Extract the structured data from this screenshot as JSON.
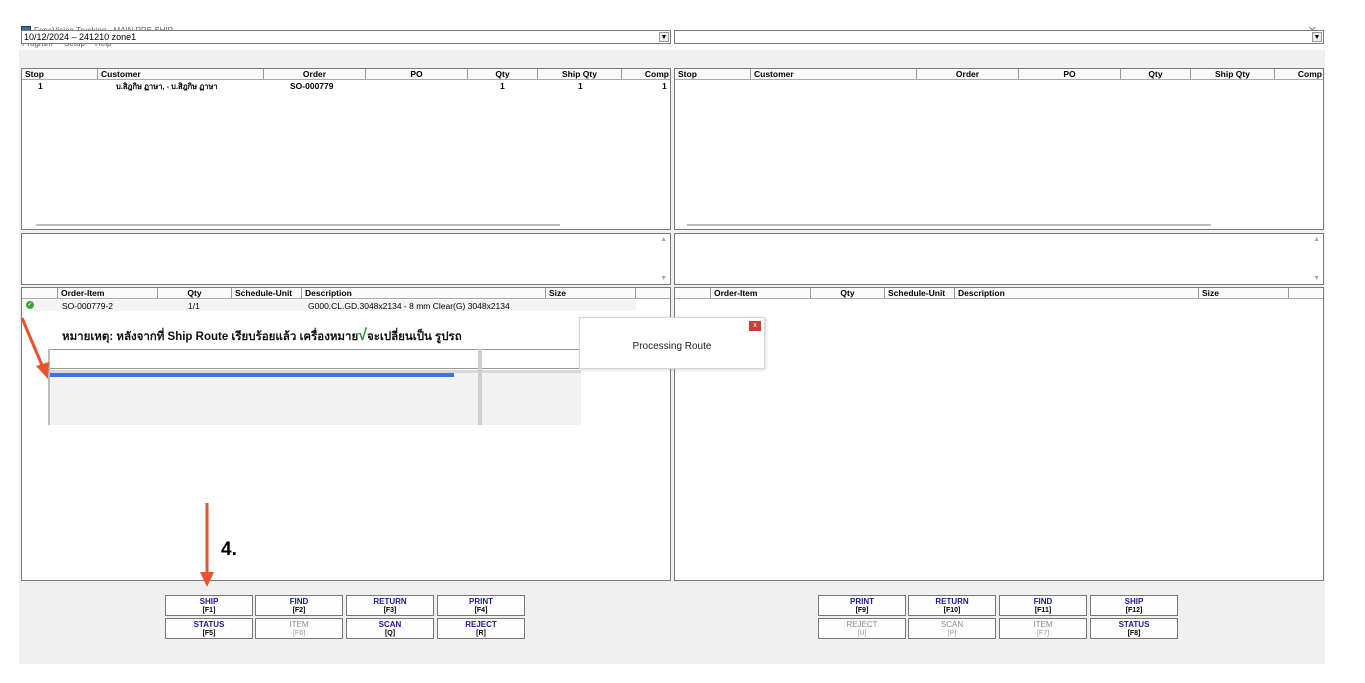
{
  "window": {
    "title": "FeneVision Trucking - MAIN.PRE SHIP",
    "menu": [
      "Program",
      "Setup",
      "Help"
    ]
  },
  "left": {
    "route_select": "10/12/2024 – 241210 zone1",
    "orders_columns": [
      "Stop",
      "Customer",
      "Order",
      "PO",
      "Qty",
      "Ship Qty",
      "Comp"
    ],
    "orders_rows": [
      {
        "stop": "1",
        "customer": "บ.สิฎกิษ ฏาษา, - บ.สิฎกิษ ฏาษา",
        "order": "SO-000779",
        "po": "",
        "qty": "1",
        "ship_qty": "1",
        "comp": "1"
      }
    ],
    "items_columns": [
      "Order-Item",
      "Qty",
      "Schedule-Unit",
      "Description",
      "Size"
    ],
    "items_rows": [
      {
        "order_item": "SO-000779-2",
        "qty": "1/1",
        "schedule_unit": "",
        "description": "G000.CL.GD.3048x2134 - 8 mm Clear(G) 3048x2134",
        "size": ""
      }
    ]
  },
  "right": {
    "route_select": "",
    "orders_columns": [
      "Stop",
      "Customer",
      "Order",
      "PO",
      "Qty",
      "Ship Qty",
      "Comp"
    ],
    "items_columns": [
      "Order-Item",
      "Qty",
      "Schedule-Unit",
      "Description",
      "Size"
    ]
  },
  "annotation": {
    "note_prefix": "หมายเหตุ:  หลังจากที่ Ship Route เรียบร้อยแล้ว เครื่องหมาย",
    "check": "√",
    "note_suffix": "จะเปลี่ยนเป็น รูปรถ",
    "step": "4."
  },
  "popup": {
    "message": "Processing Route",
    "close": "x"
  },
  "left_buttons": [
    {
      "label": "SHIP",
      "key": "[F1]",
      "enabled": true
    },
    {
      "label": "FIND",
      "key": "[F2]",
      "enabled": true
    },
    {
      "label": "RETURN",
      "key": "[F3]",
      "enabled": true
    },
    {
      "label": "PRINT",
      "key": "[F4]",
      "enabled": true
    },
    {
      "label": "STATUS",
      "key": "[F5]",
      "enabled": true
    },
    {
      "label": "ITEM",
      "key": "[F6]",
      "enabled": false
    },
    {
      "label": "SCAN",
      "key": "[Q]",
      "enabled": true
    },
    {
      "label": "REJECT",
      "key": "[R]",
      "enabled": true
    }
  ],
  "right_buttons": [
    {
      "label": "PRINT",
      "key": "[F9]",
      "enabled": true
    },
    {
      "label": "RETURN",
      "key": "[F10]",
      "enabled": true
    },
    {
      "label": "FIND",
      "key": "[F11]",
      "enabled": true
    },
    {
      "label": "SHIP",
      "key": "[F12]",
      "enabled": true
    },
    {
      "label": "REJECT",
      "key": "[U]",
      "enabled": false
    },
    {
      "label": "SCAN",
      "key": "[P]",
      "enabled": false
    },
    {
      "label": "ITEM",
      "key": "[F7]",
      "enabled": false
    },
    {
      "label": "STATUS",
      "key": "[F8]",
      "enabled": true
    }
  ],
  "colors": {
    "button_text": "#1a1a9a",
    "arrow": "#e8522c",
    "selection": "#3a78d6"
  }
}
